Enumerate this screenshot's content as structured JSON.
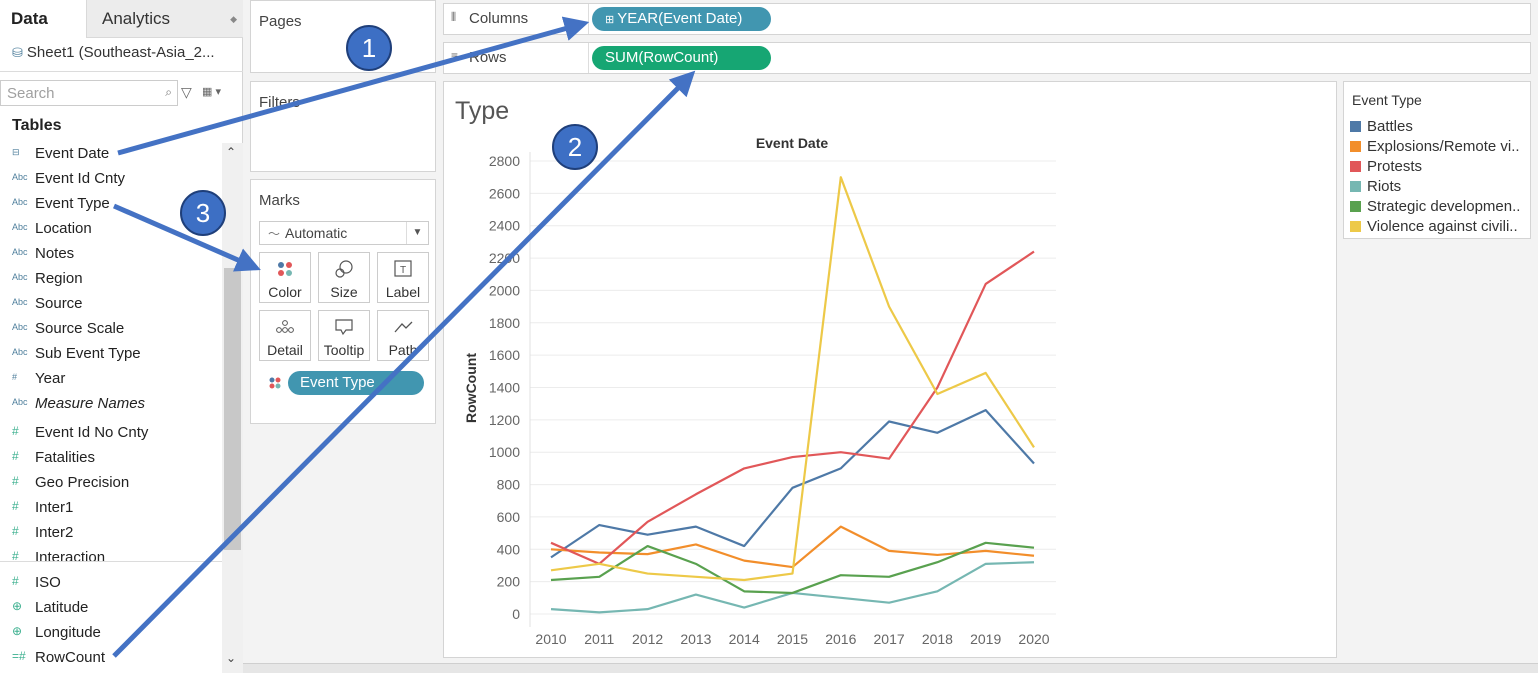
{
  "data_pane": {
    "tabs": [
      {
        "label": "Data"
      },
      {
        "label": "Analytics"
      }
    ],
    "datasource": "Sheet1 (Southeast-Asia_2...",
    "search_placeholder": "Search",
    "tables_header": "Tables",
    "fields": [
      {
        "name": "Event Date",
        "icon": "date-icon",
        "kind": "dimension"
      },
      {
        "name": "Event Id Cnty",
        "icon": "abc-icon",
        "kind": "dimension"
      },
      {
        "name": "Event Type",
        "icon": "abc-icon",
        "kind": "dimension"
      },
      {
        "name": "Location",
        "icon": "abc-icon",
        "kind": "dimension"
      },
      {
        "name": "Notes",
        "icon": "abc-icon",
        "kind": "dimension"
      },
      {
        "name": "Region",
        "icon": "abc-icon",
        "kind": "dimension"
      },
      {
        "name": "Source",
        "icon": "abc-icon",
        "kind": "dimension"
      },
      {
        "name": "Source Scale",
        "icon": "abc-icon",
        "kind": "dimension"
      },
      {
        "name": "Sub Event Type",
        "icon": "abc-icon",
        "kind": "dimension"
      },
      {
        "name": "Year",
        "icon": "hash-icon",
        "kind": "dimension"
      },
      {
        "name": "Measure Names",
        "icon": "abc-icon",
        "kind": "dimension",
        "italic": true
      },
      {
        "name": "Event Id No Cnty",
        "icon": "hash-icon",
        "kind": "measure"
      },
      {
        "name": "Fatalities",
        "icon": "hash-icon",
        "kind": "measure"
      },
      {
        "name": "Geo Precision",
        "icon": "hash-icon",
        "kind": "measure"
      },
      {
        "name": "Inter1",
        "icon": "hash-icon",
        "kind": "measure"
      },
      {
        "name": "Inter2",
        "icon": "hash-icon",
        "kind": "measure"
      },
      {
        "name": "Interaction",
        "icon": "hash-icon",
        "kind": "measure"
      },
      {
        "name": "ISO",
        "icon": "hash-icon",
        "kind": "measure"
      },
      {
        "name": "Latitude",
        "icon": "globe-icon",
        "kind": "measure"
      },
      {
        "name": "Longitude",
        "icon": "globe-icon",
        "kind": "measure"
      },
      {
        "name": "RowCount",
        "icon": "calc-hash-icon",
        "kind": "measure"
      }
    ]
  },
  "cards": {
    "pages_title": "Pages",
    "filters_title": "Filters",
    "marks_title": "Marks",
    "mark_type": "Automatic",
    "mark_buttons": [
      {
        "label": "Color",
        "icon": "color-icon"
      },
      {
        "label": "Size",
        "icon": "size-icon"
      },
      {
        "label": "Label",
        "icon": "label-icon"
      },
      {
        "label": "Detail",
        "icon": "detail-icon"
      },
      {
        "label": "Tooltip",
        "icon": "tooltip-icon"
      },
      {
        "label": "Path",
        "icon": "path-icon"
      }
    ],
    "color_pill": "Event Type"
  },
  "shelves": {
    "columns_label": "Columns",
    "columns_pill": "YEAR(Event Date)",
    "rows_label": "Rows",
    "rows_pill": "SUM(RowCount)"
  },
  "worksheet": {
    "title": "Type"
  },
  "legend": {
    "title": "Event Type",
    "items": [
      {
        "label": "Battles",
        "color": "#4e79a7"
      },
      {
        "label": "Explosions/Remote vi..",
        "color": "#f28e2b"
      },
      {
        "label": "Protests",
        "color": "#e15759"
      },
      {
        "label": "Riots",
        "color": "#76b7b2"
      },
      {
        "label": "Strategic developmen..",
        "color": "#59a14f"
      },
      {
        "label": "Violence against civili..",
        "color": "#edc948"
      }
    ]
  },
  "annotations": [
    "1",
    "2",
    "3"
  ],
  "chart_data": {
    "type": "line",
    "title": "Event Date",
    "xlabel": "",
    "ylabel": "RowCount",
    "categories": [
      "2010",
      "2011",
      "2012",
      "2013",
      "2014",
      "2015",
      "2016",
      "2017",
      "2018",
      "2019",
      "2020"
    ],
    "y_ticks": [
      0,
      200,
      400,
      600,
      800,
      1000,
      1200,
      1400,
      1600,
      1800,
      2000,
      2200,
      2400,
      2600,
      2800
    ],
    "ylim": [
      0,
      2800
    ],
    "grid": true,
    "series": [
      {
        "name": "Battles",
        "color": "#4e79a7",
        "values": [
          350,
          550,
          490,
          540,
          420,
          780,
          900,
          1190,
          1120,
          1260,
          930
        ]
      },
      {
        "name": "Explosions/Remote vi..",
        "color": "#f28e2b",
        "values": [
          400,
          380,
          370,
          430,
          330,
          290,
          540,
          390,
          365,
          390,
          360
        ]
      },
      {
        "name": "Protests",
        "color": "#e15759",
        "values": [
          440,
          310,
          570,
          740,
          900,
          970,
          1000,
          960,
          1400,
          2040,
          2240
        ]
      },
      {
        "name": "Riots",
        "color": "#76b7b2",
        "values": [
          30,
          10,
          30,
          120,
          40,
          130,
          100,
          70,
          140,
          310,
          320
        ]
      },
      {
        "name": "Strategic developmen..",
        "color": "#59a14f",
        "values": [
          210,
          230,
          420,
          310,
          140,
          130,
          240,
          230,
          320,
          440,
          410
        ]
      },
      {
        "name": "Violence against civili..",
        "color": "#edc948",
        "values": [
          270,
          310,
          250,
          230,
          210,
          250,
          2700,
          1900,
          1360,
          1490,
          1030
        ]
      }
    ]
  }
}
